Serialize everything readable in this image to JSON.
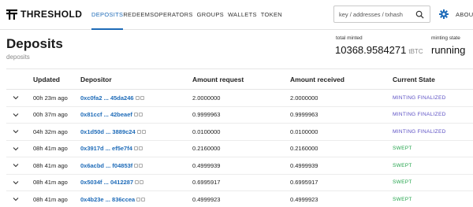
{
  "header": {
    "logo_text": "THRESHOLD",
    "nav": [
      "DEPOSITS",
      "REDEEMS",
      "OPERATORS",
      "GROUPS",
      "WALLETS",
      "TOKEN"
    ],
    "active_nav": "DEPOSITS",
    "search_placeholder": "key / addresses / txhash",
    "about_label": "ABOU"
  },
  "page": {
    "title": "Deposits",
    "subtitle": "deposits"
  },
  "stats": {
    "total_minted_label": "total minted",
    "total_minted_value": "10368.9584271",
    "total_minted_unit": "tBTC",
    "minting_state_label": "minting state",
    "minting_state_value": "running"
  },
  "table": {
    "headers": [
      "Updated",
      "Depositor",
      "Amount request",
      "Amount received",
      "Current State"
    ],
    "rows": [
      {
        "updated": "00h 23m ago",
        "depositor": "0xc0fa2 ... 45da246",
        "request": "2.0000000",
        "received": "2.0000000",
        "state": "MINTING FINALIZED"
      },
      {
        "updated": "00h 37m ago",
        "depositor": "0x81ccf ... 42beaef",
        "request": "0.9999963",
        "received": "0.9999963",
        "state": "MINTING FINALIZED"
      },
      {
        "updated": "04h 32m ago",
        "depositor": "0x1d50d ... 3889c24",
        "request": "0.0100000",
        "received": "0.0100000",
        "state": "MINTING FINALIZED"
      },
      {
        "updated": "08h 41m ago",
        "depositor": "0x3917d ... ef5e7f4",
        "request": "0.2160000",
        "received": "0.2160000",
        "state": "SWEPT"
      },
      {
        "updated": "08h 41m ago",
        "depositor": "0x6acbd ... f04853f",
        "request": "0.4999939",
        "received": "0.4999939",
        "state": "SWEPT"
      },
      {
        "updated": "08h 41m ago",
        "depositor": "0x5034f ... 0412287",
        "request": "0.6995917",
        "received": "0.6995917",
        "state": "SWEPT"
      },
      {
        "updated": "08h 41m ago",
        "depositor": "0x4b23e ... 836ccea",
        "request": "0.4999923",
        "received": "0.4999923",
        "state": "SWEPT"
      }
    ]
  },
  "colors": {
    "accent": "#1e6bb8",
    "minting_finalized": "#5b4fc4",
    "swept": "#21a34a"
  }
}
